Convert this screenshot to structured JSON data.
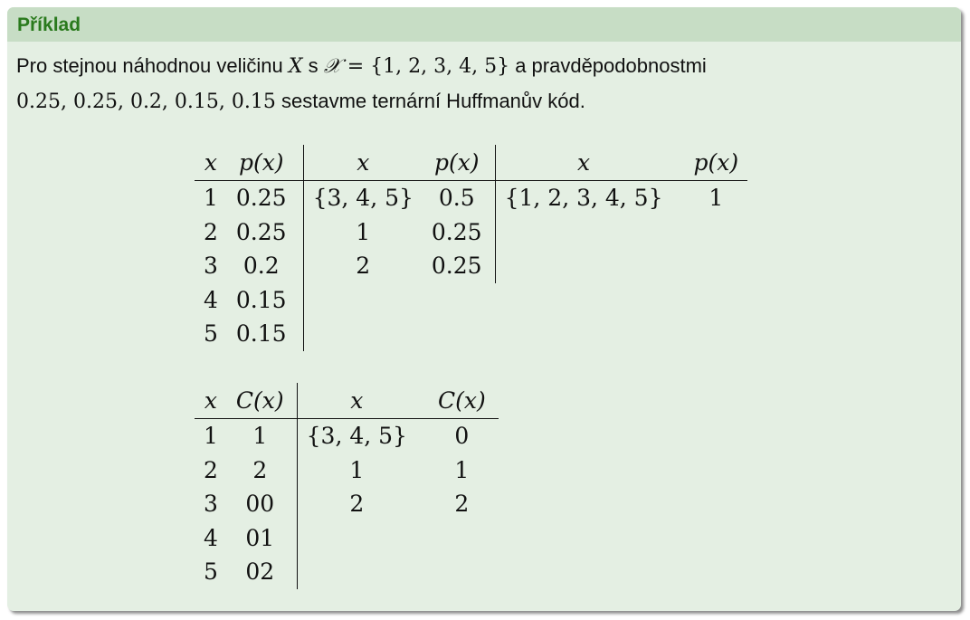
{
  "block": {
    "title": "Příklad",
    "intro": {
      "t1": "Pro stejnou náhodnou veličinu ",
      "var": "X",
      "t2": " s ",
      "set_symbol": "𝒳",
      "set_def": " = {1, 2, 3, 4, 5}",
      "t3": " a pravděpodobnostmi",
      "probs": "0.25, 0.25, 0.2, 0.15, 0.15",
      "t4": " sestavme ternární Huffmanův kód."
    }
  },
  "prob_table": {
    "headers": [
      "x",
      "p(x)",
      "x",
      "p(x)",
      "x",
      "p(x)"
    ],
    "rows": [
      [
        "1",
        "0.25",
        "{3, 4, 5}",
        "0.5",
        "{1, 2, 3, 4, 5}",
        "1"
      ],
      [
        "2",
        "0.25",
        "1",
        "0.25",
        "",
        ""
      ],
      [
        "3",
        "0.2",
        "2",
        "0.25",
        "",
        ""
      ],
      [
        "4",
        "0.15",
        "",
        "",
        "",
        ""
      ],
      [
        "5",
        "0.15",
        "",
        "",
        "",
        ""
      ]
    ]
  },
  "code_table": {
    "headers": [
      "x",
      "C(x)",
      "x",
      "C(x)"
    ],
    "rows": [
      [
        "1",
        "1",
        "{3, 4, 5}",
        "0"
      ],
      [
        "2",
        "2",
        "1",
        "1"
      ],
      [
        "3",
        "00",
        "2",
        "2"
      ],
      [
        "4",
        "01",
        "",
        ""
      ],
      [
        "5",
        "02",
        "",
        ""
      ]
    ]
  },
  "colors": {
    "title_text": "#2a7a1d",
    "title_bg": "#c7ddc5",
    "body_bg": "#e4efe3"
  }
}
